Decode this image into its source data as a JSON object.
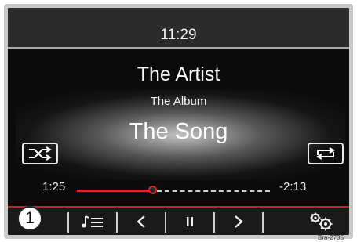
{
  "header": {
    "clock": "11:29"
  },
  "track_info": {
    "artist": "The Artist",
    "album": "The Album",
    "song": "The Song"
  },
  "controls": {
    "shuffle_icon": "shuffle-icon",
    "repeat_icon": "repeat-icon"
  },
  "progress": {
    "elapsed": "1:25",
    "remaining": "-2:13",
    "fraction": 0.39
  },
  "bottom_bar": {
    "items": [
      {
        "name": "playlist-icon",
        "glyph": "♪☰"
      },
      {
        "name": "previous-icon",
        "glyph": "<"
      },
      {
        "name": "pause-icon",
        "glyph": "II"
      },
      {
        "name": "next-icon",
        "glyph": ">"
      },
      {
        "name": "settings-icon",
        "glyph": "gears"
      }
    ]
  },
  "annotation": {
    "callout_number": "1",
    "reference_code": "Bra-2735"
  },
  "colors": {
    "accent": "#d8262a",
    "background": "#0b0b0b",
    "text": "#f2f2f2"
  }
}
